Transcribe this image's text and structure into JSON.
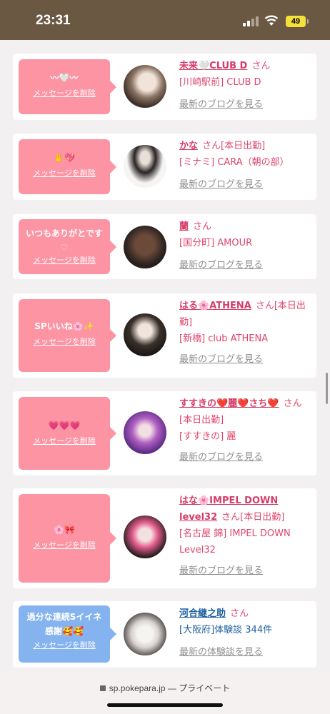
{
  "status_bar": {
    "time": "23:31",
    "battery": "49"
  },
  "colors": {
    "pink_bubble": "#fc94a4",
    "blue_bubble": "#85b3ef",
    "link_pink": "#d63c67",
    "link_blue": "#1b5fa0",
    "status_bg": "#6b5843"
  },
  "delete_label": "メッセージを削除",
  "blog_label": "最新のブログを見る",
  "review_label": "最新の体験談を見る",
  "items": [
    {
      "message": "〰🤍〰",
      "name": "未来🤍CLUB D",
      "suffix": "さん",
      "line2": "[川崎駅前] CLUB D",
      "link": "最新のブログを見る"
    },
    {
      "message": "✋💖",
      "name": "かな",
      "suffix": "さん[本日出勤]",
      "line2": "[ミナミ] CARA（朝の部）",
      "link": "最新のブログを見る"
    },
    {
      "message": "いつもありがとです♡",
      "name": "蘭",
      "suffix": "さん",
      "line2": "[国分町] AMOUR",
      "link": "最新のブログを見る"
    },
    {
      "message": "SPいいね🌸✨",
      "name": "はる🌸ATHENA",
      "suffix": "さん[本日出勤]",
      "line2": "[新橋] club ATHENA",
      "link": "最新のブログを見る"
    },
    {
      "message": "💗💗💗",
      "name": "すすきの❤️麗❤️さち❤️",
      "suffix": "さん[本日出勤]",
      "line2": "[すすきの] 麗",
      "link": "最新のブログを見る"
    },
    {
      "message": "🌸🎀",
      "name": "はな🌸IMPEL DOWN level32",
      "suffix": "さん[本日出勤]",
      "line2": "[名古屋 錦] IMPEL DOWN Level32",
      "link": "最新のブログを見る"
    },
    {
      "message": "過分な連続Sイイネ感謝🥰🥰",
      "name": "河合継之助",
      "suffix": "さん",
      "line2": "[大阪府]体験談 344件",
      "link": "最新の体験談を見る"
    }
  ],
  "url_bar": {
    "domain": "sp.pokepara.jp",
    "separator": "—",
    "mode": "プライベート"
  }
}
